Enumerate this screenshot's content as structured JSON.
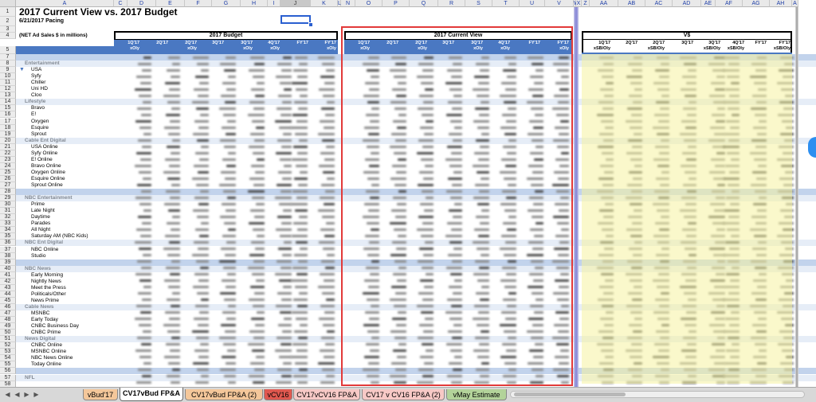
{
  "sheet": {
    "title": "2017 Current View vs. 2017 Budget",
    "subtitle": "6/21/2017 Pacing",
    "units_note": "(NET Ad Sales $ in millions)",
    "columns": [
      "A",
      "C",
      "D",
      "E",
      "F",
      "G",
      "H",
      "I",
      "J",
      "K",
      "L",
      "N",
      "O",
      "P",
      "Q",
      "R",
      "S",
      "T",
      "U",
      "V",
      "W",
      "X",
      "Z",
      "AA",
      "AB",
      "AC",
      "AD",
      "AE",
      "AF",
      "AG",
      "AH",
      "A"
    ],
    "selected_column": "J",
    "groups": {
      "budget": "2017 Budget",
      "current_view": "2017 Current View",
      "variance": "V$"
    },
    "budget_headers": [
      [
        "1Q'17",
        "xOly"
      ],
      [
        "",
        "2Q'17"
      ],
      [
        "2Q'17",
        "xOly"
      ],
      [
        "",
        "3Q'17"
      ],
      [
        "3Q'17",
        "xOly"
      ],
      [
        "4Q'17",
        "xOly"
      ],
      [
        "",
        "FY'17"
      ],
      [
        "FY'17",
        "xOly"
      ]
    ],
    "cv_headers": [
      [
        "1Q'17",
        "xOly"
      ],
      [
        "",
        "2Q'17"
      ],
      [
        "2Q'17",
        "xOly"
      ],
      [
        "",
        "3Q'17"
      ],
      [
        "3Q'17",
        "xOly"
      ],
      [
        "4Q'17",
        "xOly"
      ],
      [
        "",
        "FY'17"
      ],
      [
        "FY'17",
        "xOly"
      ]
    ],
    "variance_headers": [
      [
        "1Q'17",
        "xSB/Oly"
      ],
      [
        "",
        "2Q'17"
      ],
      [
        "2Q'17",
        "xSB/Oly"
      ],
      [
        "",
        "3Q'17"
      ],
      [
        "3Q'17",
        "xSB/Oly"
      ],
      [
        "4Q'17",
        "xSB/Oly"
      ],
      [
        "",
        "FY'17"
      ],
      [
        "FY'17",
        "xSB/Oly"
      ]
    ],
    "rows": [
      {
        "n": "1",
        "label": "",
        "indent": 0,
        "style": "plain"
      },
      {
        "n": "2",
        "label": "",
        "indent": 0,
        "style": "plain"
      },
      {
        "n": "3",
        "label": "",
        "indent": 0,
        "style": "plain"
      },
      {
        "n": "4",
        "label": "",
        "indent": 0,
        "style": "plain"
      },
      {
        "n": "5",
        "label": "",
        "indent": 0,
        "style": "plain"
      },
      {
        "n": "7",
        "label": "Cable Entertainment",
        "indent": 0,
        "style": "section"
      },
      {
        "n": "8",
        "label": "Entertainment",
        "indent": 1,
        "style": "subsection"
      },
      {
        "n": "9",
        "label": "USA",
        "indent": 2,
        "style": "item"
      },
      {
        "n": "10",
        "label": "Syfy",
        "indent": 2,
        "style": "item"
      },
      {
        "n": "11",
        "label": "Chiller",
        "indent": 2,
        "style": "item"
      },
      {
        "n": "12",
        "label": "Uni HD",
        "indent": 2,
        "style": "item"
      },
      {
        "n": "13",
        "label": "Cloo",
        "indent": 2,
        "style": "item"
      },
      {
        "n": "14",
        "label": "Lifestyle",
        "indent": 1,
        "style": "subsection"
      },
      {
        "n": "15",
        "label": "Bravo",
        "indent": 2,
        "style": "item"
      },
      {
        "n": "16",
        "label": "E!",
        "indent": 2,
        "style": "item"
      },
      {
        "n": "17",
        "label": "Oxygen",
        "indent": 2,
        "style": "item"
      },
      {
        "n": "18",
        "label": "Esquire",
        "indent": 2,
        "style": "item"
      },
      {
        "n": "19",
        "label": "Sprout",
        "indent": 2,
        "style": "item"
      },
      {
        "n": "20",
        "label": "Cable Ent Digital",
        "indent": 1,
        "style": "subsection"
      },
      {
        "n": "21",
        "label": "USA Online",
        "indent": 2,
        "style": "item"
      },
      {
        "n": "22",
        "label": "Syfy Online",
        "indent": 2,
        "style": "item"
      },
      {
        "n": "23",
        "label": "E! Online",
        "indent": 2,
        "style": "item"
      },
      {
        "n": "24",
        "label": "Bravo Online",
        "indent": 2,
        "style": "item"
      },
      {
        "n": "25",
        "label": "Oxygen Online",
        "indent": 2,
        "style": "item"
      },
      {
        "n": "26",
        "label": "Esquire Online",
        "indent": 2,
        "style": "item"
      },
      {
        "n": "27",
        "label": "Sprout Online",
        "indent": 2,
        "style": "item"
      },
      {
        "n": "28",
        "label": "NBC Entertainment",
        "indent": 0,
        "style": "section"
      },
      {
        "n": "29",
        "label": "NBC Entertainment",
        "indent": 1,
        "style": "subsection"
      },
      {
        "n": "30",
        "label": "Prime",
        "indent": 2,
        "style": "item"
      },
      {
        "n": "31",
        "label": "Late Night",
        "indent": 2,
        "style": "item"
      },
      {
        "n": "32",
        "label": "Daytime",
        "indent": 2,
        "style": "item"
      },
      {
        "n": "33",
        "label": "Parades",
        "indent": 2,
        "style": "item"
      },
      {
        "n": "34",
        "label": "All Night",
        "indent": 2,
        "style": "item"
      },
      {
        "n": "35",
        "label": "Saturday AM (NBC Kids)",
        "indent": 2,
        "style": "item"
      },
      {
        "n": "36",
        "label": "NBC Ent Digital",
        "indent": 1,
        "style": "subsection"
      },
      {
        "n": "37",
        "label": "NBC Online",
        "indent": 2,
        "style": "item"
      },
      {
        "n": "38",
        "label": "Studio",
        "indent": 2,
        "style": "item"
      },
      {
        "n": "39",
        "label": "News",
        "indent": 0,
        "style": "section"
      },
      {
        "n": "40",
        "label": "NBC News",
        "indent": 1,
        "style": "subsection"
      },
      {
        "n": "41",
        "label": "Early Morning",
        "indent": 2,
        "style": "item"
      },
      {
        "n": "42",
        "label": "Nightly News",
        "indent": 2,
        "style": "item"
      },
      {
        "n": "43",
        "label": "Meet the Press",
        "indent": 2,
        "style": "item"
      },
      {
        "n": "44",
        "label": "Politicals/Other",
        "indent": 2,
        "style": "item"
      },
      {
        "n": "45",
        "label": "News Prime",
        "indent": 2,
        "style": "item"
      },
      {
        "n": "46",
        "label": "Cable News",
        "indent": 1,
        "style": "subsection"
      },
      {
        "n": "47",
        "label": "MSNBC",
        "indent": 2,
        "style": "item"
      },
      {
        "n": "48",
        "label": "Early Today",
        "indent": 2,
        "style": "item"
      },
      {
        "n": "49",
        "label": "CNBC Business Day",
        "indent": 2,
        "style": "item"
      },
      {
        "n": "50",
        "label": "CNBC Prime",
        "indent": 2,
        "style": "item"
      },
      {
        "n": "51",
        "label": "News Digital",
        "indent": 1,
        "style": "subsection"
      },
      {
        "n": "52",
        "label": "CNBC Online",
        "indent": 2,
        "style": "item"
      },
      {
        "n": "53",
        "label": "MSNBC Online",
        "indent": 2,
        "style": "item"
      },
      {
        "n": "54",
        "label": "NBC News Online",
        "indent": 2,
        "style": "item"
      },
      {
        "n": "55",
        "label": "Today Online",
        "indent": 2,
        "style": "item"
      },
      {
        "n": "56",
        "label": "Sports",
        "indent": 0,
        "style": "section"
      },
      {
        "n": "57",
        "label": "NFL",
        "indent": 1,
        "style": "subsection"
      },
      {
        "n": "58",
        "label": "",
        "indent": 2,
        "style": "item"
      }
    ]
  },
  "tabs": [
    {
      "label": "vBud'17",
      "color": "#f4c79a",
      "active": false
    },
    {
      "label": "CV17vBud FP&A",
      "color": "#ffffff",
      "active": true
    },
    {
      "label": "CV17vBud FP&A (2)",
      "color": "#f4c79a",
      "active": false
    },
    {
      "label": "vCV16",
      "color": "#e0584f",
      "active": false
    },
    {
      "label": "CV17vCV16 FP&A",
      "color": "#f7c9c6",
      "active": false
    },
    {
      "label": "CV17 v CV16 FP&A (2)",
      "color": "#f7c9c6",
      "active": false
    },
    {
      "label": "vMay Estimate",
      "color": "#b3d39a",
      "active": false
    }
  ],
  "colors": {
    "header_blue": "#4a78c2",
    "section_blue": "#c2d3ec",
    "variance_yellow": "#f6f3a0",
    "cv_border_red": "#e23a3a"
  }
}
